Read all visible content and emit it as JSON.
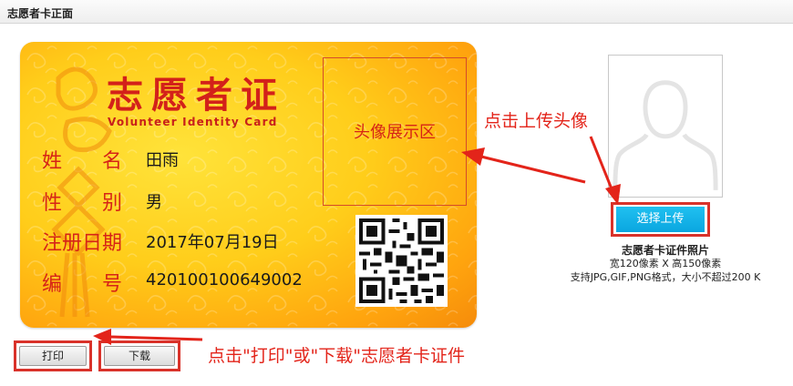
{
  "panel": {
    "title": "志愿者卡正面"
  },
  "card": {
    "title": "志愿者证",
    "subtitle": "Volunteer Identity Card",
    "photo_placeholder": "头像展示区",
    "fields": [
      {
        "label_chars": [
          "姓",
          "名"
        ],
        "value": "田雨"
      },
      {
        "label_chars": [
          "性",
          "别"
        ],
        "value": "男"
      },
      {
        "label": "注册日期",
        "value": "2017年07月19日"
      },
      {
        "label_chars": [
          "编",
          "号"
        ],
        "value": "420100100649002"
      }
    ],
    "colors": {
      "accent_red": "#d3211a",
      "card_yellow": "#ffcd1a",
      "card_orange": "#f58b0a"
    }
  },
  "upload": {
    "button_label": "选择上传",
    "caption_title": "志愿者卡证件照片",
    "caption_size": "宽120像素 X 高150像素",
    "caption_format": "支持JPG,GIF,PNG格式，大小不超过200 K"
  },
  "actions": {
    "print_label": "打印",
    "download_label": "下载"
  },
  "annotations": {
    "upload_note": "点击上传头像",
    "print_note": "点击\"打印\"或\"下载\"志愿者卡证件"
  },
  "icons": {
    "avatar": "person-silhouette-icon",
    "qr": "qr-code-icon"
  }
}
